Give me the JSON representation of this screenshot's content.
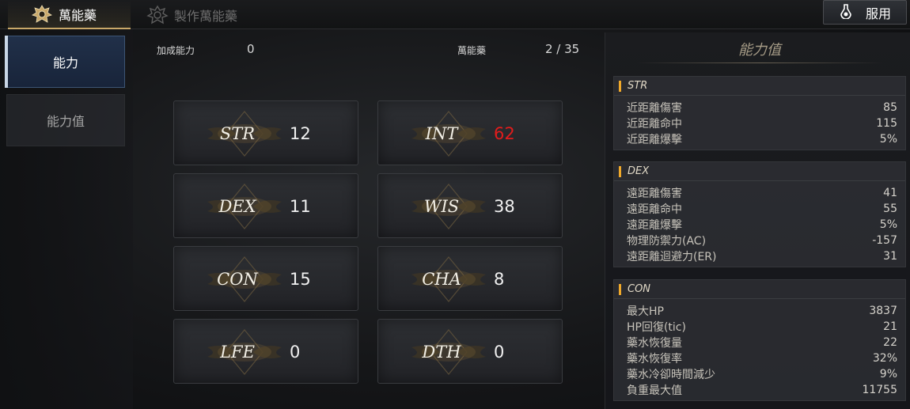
{
  "tabs": [
    {
      "label": "萬能藥",
      "icon": "crest-icon",
      "active": true
    },
    {
      "label": "製作萬能藥",
      "icon": "crafting-crest-icon",
      "active": false
    }
  ],
  "use_button": {
    "label": "服用",
    "icon": "potion-flask-icon"
  },
  "nav": [
    {
      "label": "能力",
      "active": true
    },
    {
      "label": "能力值",
      "active": false
    }
  ],
  "header": {
    "bonus_label": "加成能力",
    "bonus_value": "0",
    "elixir_label": "萬能藥",
    "elixir_count": "2 / 35"
  },
  "stats": [
    {
      "name": "STR",
      "value": "12"
    },
    {
      "name": "INT",
      "value": "62",
      "highlight": "#e21c1c"
    },
    {
      "name": "DEX",
      "value": "11"
    },
    {
      "name": "WIS",
      "value": "38"
    },
    {
      "name": "CON",
      "value": "15"
    },
    {
      "name": "CHA",
      "value": "8"
    },
    {
      "name": "LFE",
      "value": "0"
    },
    {
      "name": "DTH",
      "value": "0"
    }
  ],
  "ability_panel": {
    "title": "能力值",
    "sections": [
      {
        "name": "STR",
        "rows": [
          {
            "label": "近距離傷害",
            "value": "85"
          },
          {
            "label": "近距離命中",
            "value": "115"
          },
          {
            "label": "近距離爆擊",
            "value": "5%"
          }
        ]
      },
      {
        "name": "DEX",
        "rows": [
          {
            "label": "遠距離傷害",
            "value": "41"
          },
          {
            "label": "遠距離命中",
            "value": "55"
          },
          {
            "label": "遠距離爆擊",
            "value": "5%"
          },
          {
            "label": "物理防禦力(AC)",
            "value": "-157"
          },
          {
            "label": "遠距離迴避力(ER)",
            "value": "31"
          }
        ]
      },
      {
        "name": "CON",
        "rows": [
          {
            "label": "最大HP",
            "value": "3837"
          },
          {
            "label": "HP回復(tic)",
            "value": "21"
          },
          {
            "label": "藥水恢復量",
            "value": "22"
          },
          {
            "label": "藥水恢復率",
            "value": "32%"
          },
          {
            "label": "藥水冷卻時間減少",
            "value": "9%"
          },
          {
            "label": "負重最大值",
            "value": "11755"
          }
        ]
      }
    ]
  },
  "colors": {
    "accent_gold": "#c9a869",
    "section_marker": "#f0a92a",
    "highlight_red": "#e21c1c",
    "nav_active": "#213049"
  }
}
